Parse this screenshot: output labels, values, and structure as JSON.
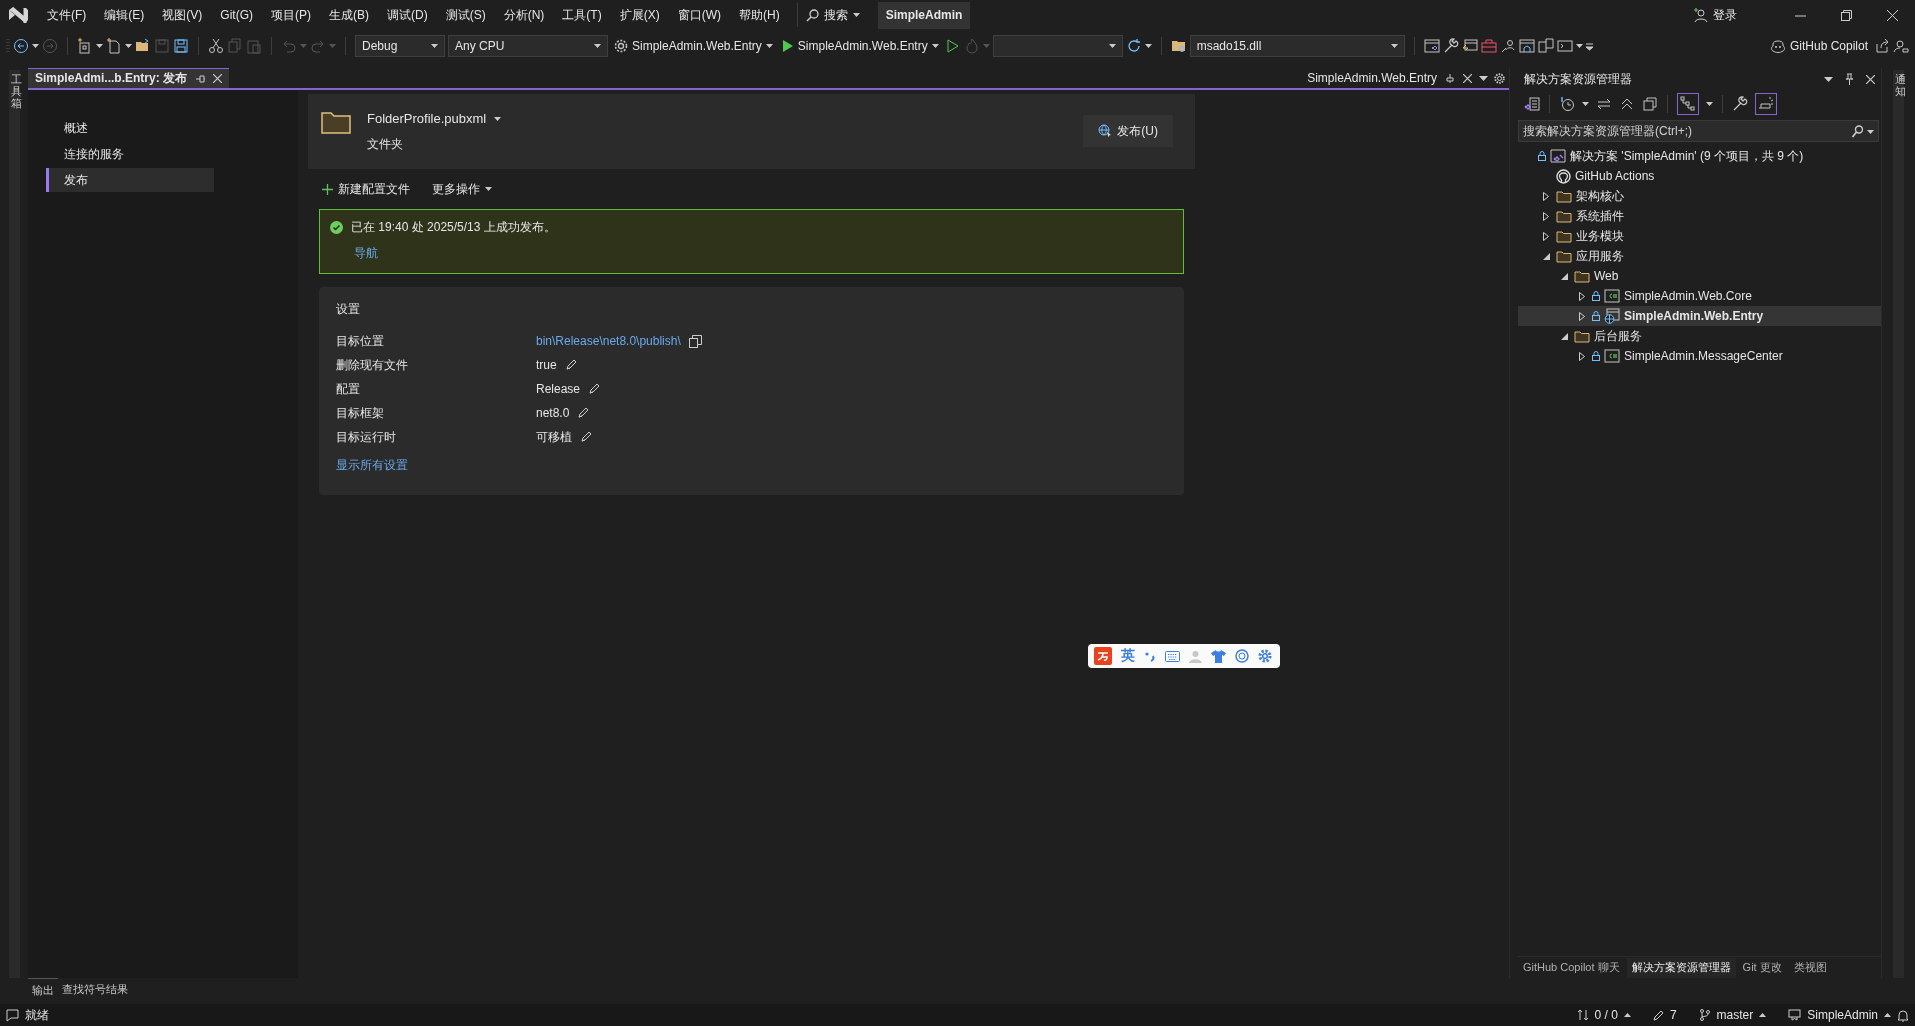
{
  "title_bar": {
    "menu": [
      "文件(F)",
      "编辑(E)",
      "视图(V)",
      "Git(G)",
      "项目(P)",
      "生成(B)",
      "调试(D)",
      "测试(S)",
      "分析(N)",
      "工具(T)",
      "扩展(X)",
      "窗口(W)",
      "帮助(H)"
    ],
    "search": "搜索",
    "solution_name": "SimpleAdmin",
    "sign_in": "登录"
  },
  "toolbar": {
    "configuration": "Debug",
    "platform": "Any CPU",
    "startup_project": "SimpleAdmin.Web.Entry",
    "run_target": "SimpleAdmin.Web.Entry",
    "file": "msado15.dll",
    "copilot": "GitHub Copilot"
  },
  "left_strip": {
    "label": "工具箱"
  },
  "right_strip": {
    "label": "通知"
  },
  "document_tabs": [
    {
      "label": "SimpleAdmi...b.Entry: 发布",
      "selected": true
    },
    {
      "label": "SimpleAdmin.Web.Entry",
      "selected": false
    }
  ],
  "publish_page": {
    "nav": [
      {
        "label": "概述",
        "selected": false
      },
      {
        "label": "连接的服务",
        "selected": false
      },
      {
        "label": "发布",
        "selected": true
      }
    ],
    "profile": {
      "name": "FolderProfile.pubxml",
      "type": "文件夹",
      "publish_button": "发布(U)"
    },
    "actions": [
      "新建配置文件",
      "更多操作"
    ],
    "status": {
      "message": "已在 19:40 处 2025/5/13 上成功发布。",
      "link": "导航"
    },
    "settings": {
      "title": "设置",
      "rows": [
        {
          "label": "目标位置",
          "value": "bin\\Release\\net8.0\\publish\\",
          "kind": "path"
        },
        {
          "label": "删除现有文件",
          "value": "true",
          "kind": "editable"
        },
        {
          "label": "配置",
          "value": "Release",
          "kind": "editable"
        },
        {
          "label": "目标框架",
          "value": "net8.0",
          "kind": "editable"
        },
        {
          "label": "目标运行时",
          "value": "可移植",
          "kind": "editable"
        }
      ],
      "show_all": "显示所有设置"
    }
  },
  "solution_explorer": {
    "title": "解决方案资源管理器",
    "search": {
      "placeholder": "搜索解决方案资源管理器(Ctrl+;)"
    },
    "tree": [
      {
        "label": "解决方案 'SimpleAdmin' (9 个项目，共 9 个)",
        "kind": "solution",
        "selected": false
      },
      {
        "label": "GitHub Actions",
        "kind": "github",
        "selected": false
      },
      {
        "label": "架构核心",
        "kind": "folder",
        "expanded": false,
        "selected": false
      },
      {
        "label": "系统插件",
        "kind": "folder",
        "expanded": false,
        "selected": false
      },
      {
        "label": "业务模块",
        "kind": "folder",
        "expanded": false,
        "selected": false
      },
      {
        "label": "应用服务",
        "kind": "folder",
        "expanded": true,
        "selected": false,
        "children": [
          {
            "label": "Web",
            "kind": "folder",
            "expanded": true,
            "selected": false,
            "children": [
              {
                "label": "SimpleAdmin.Web.Core",
                "kind": "csproj",
                "expanded": false,
                "selected": false
              },
              {
                "label": "SimpleAdmin.Web.Entry",
                "kind": "webproj",
                "expanded": false,
                "selected": true
              }
            ]
          },
          {
            "label": "后台服务",
            "kind": "folder",
            "expanded": true,
            "selected": false,
            "children": [
              {
                "label": "SimpleAdmin.MessageCenter",
                "kind": "csproj",
                "expanded": false,
                "selected": false
              }
            ]
          }
        ]
      }
    ],
    "bottom_tabs": [
      {
        "label": "GitHub Copilot 聊天",
        "selected": false
      },
      {
        "label": "解决方案资源管理器",
        "selected": true
      },
      {
        "label": "Git 更改",
        "selected": false
      },
      {
        "label": "类视图",
        "selected": false
      }
    ]
  },
  "bottom_panel_tabs": [
    "输出",
    "查找符号结果"
  ],
  "ime_toolbar": {
    "language": "英"
  },
  "status_bar": {
    "state": "就绪",
    "changes": "0 / 0",
    "edits": "7",
    "branch": "master",
    "repository": "SimpleAdmin"
  }
}
